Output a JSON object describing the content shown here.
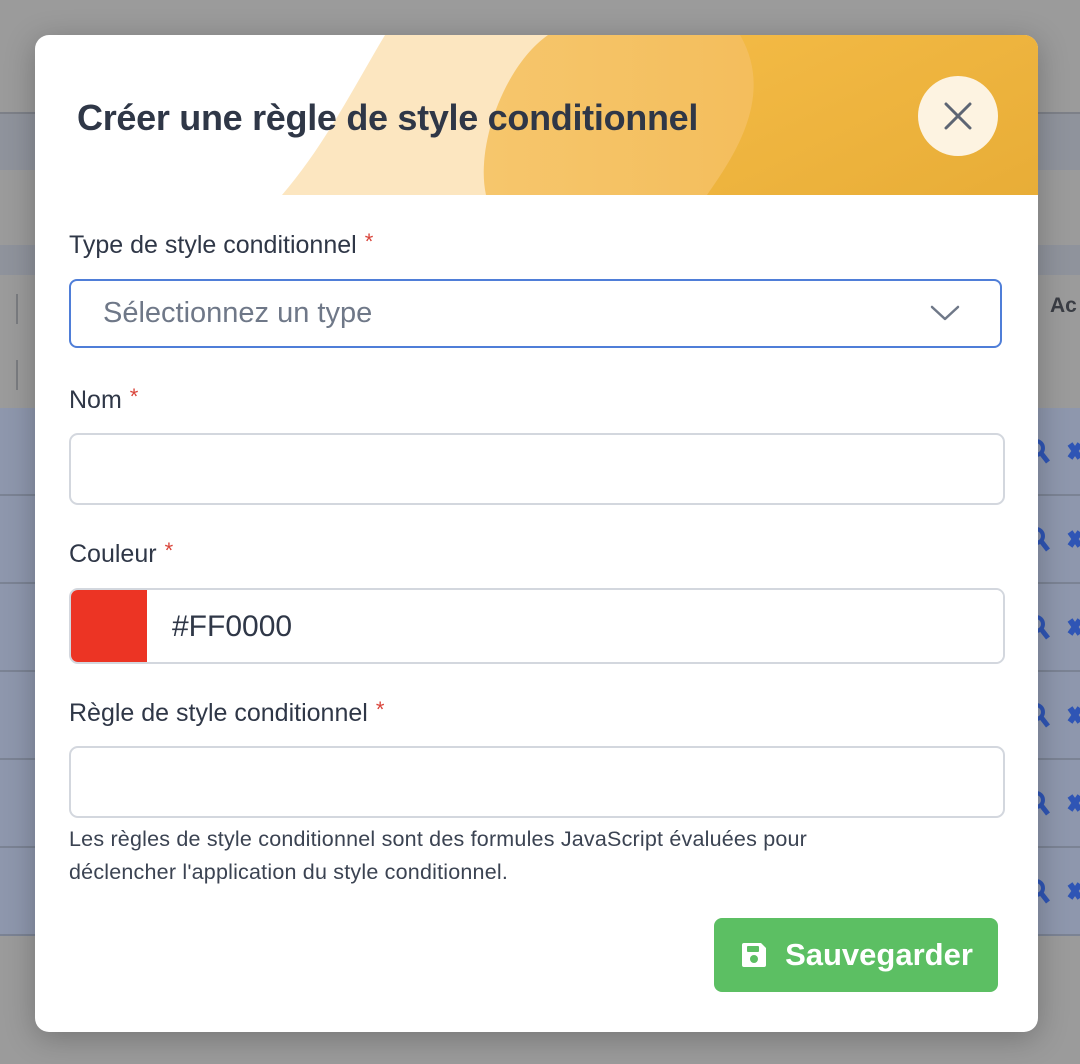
{
  "modal": {
    "title": "Créer une règle de style conditionnel",
    "required_mark": "*",
    "fields": {
      "type": {
        "label": "Type de style conditionnel",
        "placeholder": "Sélectionnez un type"
      },
      "name": {
        "label": "Nom",
        "value": ""
      },
      "color": {
        "label": "Couleur",
        "value": "#FF0000"
      },
      "rule": {
        "label": "Règle de style conditionnel",
        "value": "",
        "help_line1": "Les règles de style conditionnel sont des formules JavaScript évaluées pour",
        "help_line2": "déclencher l'application du style conditionnel."
      }
    },
    "save_label": "Sauvegarder",
    "icons": {
      "close": "close-icon",
      "chevron": "chevron-down-icon",
      "save": "floppy-disk-icon"
    }
  },
  "background": {
    "column_header_fragment": "Ac"
  },
  "colors": {
    "title": "#2f3747",
    "required": "#d9443a",
    "select_border": "#4f7ed8",
    "swatch": "#ec3424",
    "save_button": "#5cbf63",
    "header_accent": "#ecb43c"
  }
}
